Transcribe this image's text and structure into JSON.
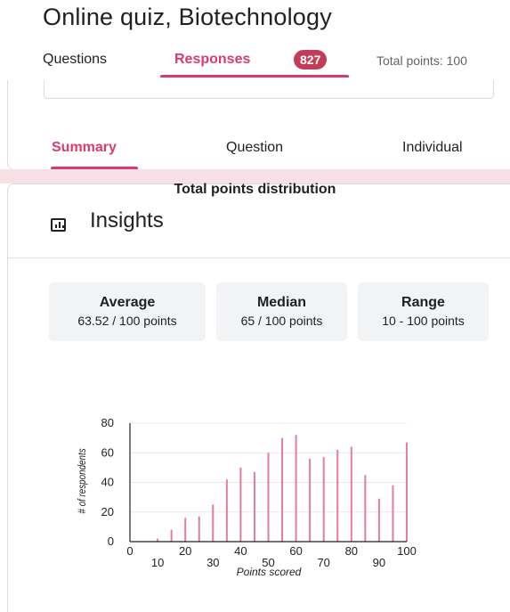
{
  "header": {
    "title": "Online quiz, Biotechnology"
  },
  "tabs": {
    "questions": "Questions",
    "responses": "Responses",
    "responses_count": "827",
    "total_points": "Total points: 100"
  },
  "subtabs": {
    "summary": "Summary",
    "question": "Question",
    "individual": "Individual"
  },
  "insights": {
    "title": "Insights",
    "stats": [
      {
        "label": "Average",
        "value": "63.52 / 100 points"
      },
      {
        "label": "Median",
        "value": "65 / 100 points"
      },
      {
        "label": "Range",
        "value": "10 - 100 points"
      }
    ]
  },
  "colors": {
    "accent": "#d93c6b",
    "badge": "#c53c59",
    "bar": "#e17e99",
    "tint": "#f7e1e7"
  },
  "chart_data": {
    "type": "bar",
    "title": "Total points distribution",
    "xlabel": "Points scored",
    "ylabel": "# of respondents",
    "xlim": [
      0,
      100
    ],
    "ylim": [
      0,
      80
    ],
    "yticks": [
      0,
      20,
      40,
      60,
      80
    ],
    "xticks": [
      0,
      10,
      20,
      30,
      40,
      50,
      60,
      70,
      80,
      90,
      100
    ],
    "x": [
      10,
      15,
      20,
      25,
      30,
      35,
      40,
      45,
      50,
      55,
      60,
      65,
      70,
      75,
      80,
      85,
      90,
      95,
      100
    ],
    "values": [
      2,
      8,
      16,
      17,
      25,
      42,
      50,
      47,
      60,
      70,
      72,
      56,
      57,
      62,
      64,
      45,
      29,
      38,
      67
    ]
  }
}
